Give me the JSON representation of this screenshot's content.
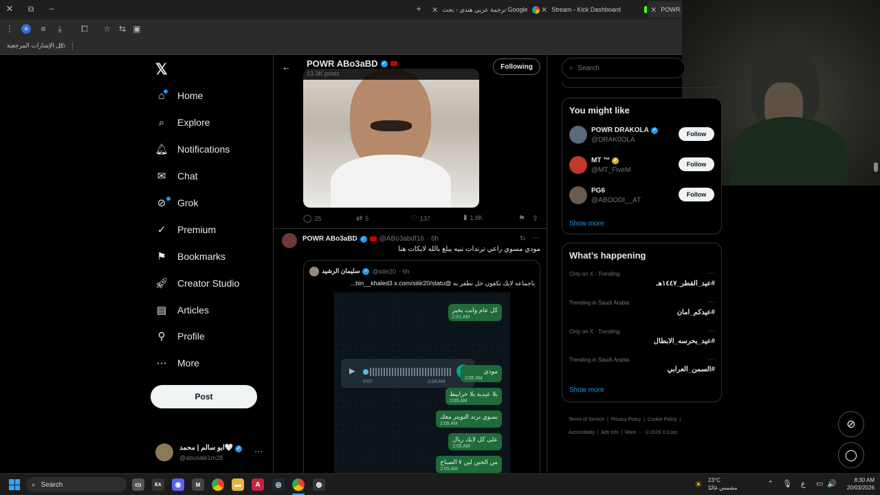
{
  "browser": {
    "tabs": [
      {
        "label": "ترجمة عربي هندي - بحث Google"
      },
      {
        "label": "Stream - Kick Dashboard"
      },
      {
        "label": "POWR A"
      }
    ],
    "bookmarks_label": "كل الإشارات المرجعية",
    "profile_letter": "a"
  },
  "nav": {
    "items": [
      {
        "label": "Home",
        "icon": "home-icon"
      },
      {
        "label": "Explore",
        "icon": "search-icon"
      },
      {
        "label": "Notifications",
        "icon": "bell-icon"
      },
      {
        "label": "Chat",
        "icon": "mail-icon"
      },
      {
        "label": "Grok",
        "icon": "grok-icon"
      },
      {
        "label": "Premium",
        "icon": "premium-icon"
      },
      {
        "label": "Bookmarks",
        "icon": "bookmark-icon"
      },
      {
        "label": "Creator Studio",
        "icon": "rocket-icon"
      },
      {
        "label": "Articles",
        "icon": "articles-icon"
      },
      {
        "label": "Profile",
        "icon": "person-icon"
      },
      {
        "label": "More",
        "icon": "more-icon"
      }
    ],
    "post_label": "Post",
    "account": {
      "name": "ابو سالم | محمد🤍",
      "handle": "@abusale1m28"
    }
  },
  "profile_header": {
    "name": "POWR ABo3aBD",
    "posts": "13.3K posts",
    "following_label": "Following"
  },
  "post1_stats": {
    "replies": "25",
    "reposts": "5",
    "likes": "137",
    "views": "1.8K"
  },
  "post2": {
    "name": "POWR ABo3aBD",
    "handle": "@ABo3abdf16",
    "time": "· 6h",
    "text": "مودي مسوي راعي ترندات نبيه يبلع بالله لايكات هنا",
    "quote": {
      "name": "سليمان الرشيد",
      "handle": "@siiiir20",
      "time": "· 6h",
      "text": "ياجماعه لايك تكفون خل نطفر به @bin__khaled3",
      "link": "x.com/siiiir20/statu..."
    },
    "chat": [
      {
        "text": "كل عام وانت بخير",
        "time": "2:01 AM"
      },
      {
        "text": "مودي",
        "time": "2:05 AM"
      },
      {
        "text": "بلا عيديه بلا خرابيط",
        "time": "2:05 AM"
      },
      {
        "text": "بسوي ترند التويتر معك",
        "time": "2:05 AM"
      },
      {
        "text": "على كل لايك ريال",
        "time": "2:05 AM"
      },
      {
        "text": "من الحين لين ٧ الصباح",
        "time": "2:05 AM"
      }
    ],
    "voice": {
      "elapsed": "0:07",
      "time": "2:04 AM"
    }
  },
  "search_placeholder": "Search",
  "suggestions": {
    "title": "You might like",
    "items": [
      {
        "name": "POWR DRAKOLA",
        "handle": "@DRAK0OLA",
        "follow": "Follow"
      },
      {
        "name": "MT ™",
        "handle": "@MT_FiveM",
        "follow": "Follow"
      },
      {
        "name": "PG6",
        "handle": "@ABOODI__AT",
        "follow": "Follow"
      }
    ],
    "show_more": "Show more"
  },
  "trends": {
    "title": "What’s happening",
    "items": [
      {
        "category": "Only on X · Trending",
        "tag": "#عيد_الفطر_١٤٤٧هـ"
      },
      {
        "category": "Trending in Saudi Arabia",
        "tag": "#عيدكم_امان"
      },
      {
        "category": "Only on X · Trending",
        "tag": "#عيد_بحرسه_الابطال"
      },
      {
        "category": "Trending in Saudi Arabia",
        "tag": "#السمن_العرابي"
      }
    ],
    "show_more": "Show more"
  },
  "footer": {
    "links": [
      "Terms of Service",
      "Privacy Policy",
      "Cookie Policy",
      "Accessibility",
      "Ads info",
      "More ···"
    ],
    "copyright": "© 2026 X Corp."
  },
  "taskbar": {
    "search_label": "Search",
    "weather_temp": "23°C",
    "weather_desc": "مشمس غالبًا",
    "lang": "ع",
    "time": "8:30 AM",
    "date": "20/03/2026"
  }
}
